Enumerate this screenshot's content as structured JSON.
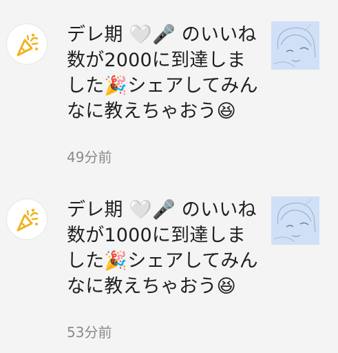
{
  "notifications": [
    {
      "icon": "party-popper-icon",
      "message": "デレ期 🤍🎤 のいいね数が2000に到達しました🎉シェアしてみんなに教えちゃおう😆",
      "time": "49分前",
      "thumbnail": "artwork-thumbnail"
    },
    {
      "icon": "party-popper-icon",
      "message": "デレ期 🤍🎤 のいいね数が1000に到達しました🎉シェアしてみんなに教えちゃおう😆",
      "time": "53分前",
      "thumbnail": "artwork-thumbnail"
    }
  ],
  "colors": {
    "background": "#f4f4f4",
    "icon_accent": "#f0b323",
    "text": "#1f1f1f",
    "time_text": "#8a8a8a",
    "thumbnail_bg": "#cfe0f7"
  }
}
